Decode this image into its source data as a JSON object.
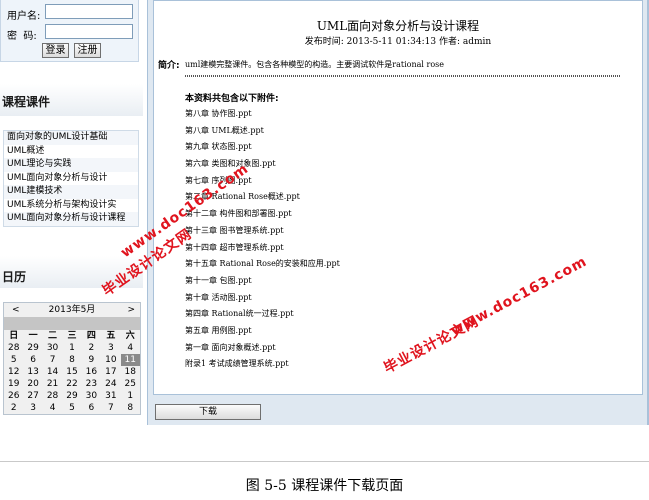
{
  "login": {
    "username_label": "用户名:",
    "password_label": "密  码:",
    "username_value": "",
    "password_value": "",
    "login_button": "登录",
    "register_button": "注册"
  },
  "courses": {
    "title": "课程课件",
    "items": [
      "面向对象的UML设计基础",
      "UML概述",
      "UML理论与实践",
      "UML面向对象分析与设计",
      "UML建模技术",
      "UML系统分析与架构设计实",
      "UML面向对象分析与设计课程"
    ]
  },
  "calendar": {
    "title": "日历",
    "month_label": "2013年5月",
    "prev": "<",
    "next": ">",
    "weekdays": [
      "日",
      "一",
      "二",
      "三",
      "四",
      "五",
      "六"
    ],
    "weeks": [
      [
        "28",
        "29",
        "30",
        "1",
        "2",
        "3",
        "4"
      ],
      [
        "5",
        "6",
        "7",
        "8",
        "9",
        "10",
        "11"
      ],
      [
        "12",
        "13",
        "14",
        "15",
        "16",
        "17",
        "18"
      ],
      [
        "19",
        "20",
        "21",
        "22",
        "23",
        "24",
        "25"
      ],
      [
        "26",
        "27",
        "28",
        "29",
        "30",
        "31",
        "1"
      ],
      [
        "2",
        "3",
        "4",
        "5",
        "6",
        "7",
        "8"
      ]
    ],
    "today": "11"
  },
  "document": {
    "title": "UML面向对象分析与设计课程",
    "meta": "发布时间: 2013-5-11 01:34:13 作者: admin",
    "intro_label": "简介:",
    "intro_text": "uml建模完整课件。包含各种模型的构造。主要调试软件是rational rose",
    "separator": "==========================================================================================",
    "attachments_heading": "本资料共包含以下附件:",
    "attachments": [
      "第八章 协作图.ppt",
      "第八章 UML概述.ppt",
      "第九章 状态图.ppt",
      "第六章 类图和对象图.ppt",
      "第七章 序列图.ppt",
      "第二章 Rational Rose概述.ppt",
      "第十二章 构件图和部署图.ppt",
      "第十三章 图书管理系统.ppt",
      "第十四章 超市管理系统.ppt",
      "第十五章 Rational Rose的安装和应用.ppt",
      "第十一章 包图.ppt",
      "第十章 活动图.ppt",
      "第四章 Rational统一过程.ppt",
      "第五章 用例图.ppt",
      "第一章 面向对象概述.ppt",
      "附录1 考试成绩管理系统.ppt"
    ],
    "download_button": "下载"
  },
  "watermark": {
    "text_cn": "毕业设计论文网",
    "text_url": "www.doc163.com"
  },
  "caption": "图 5-5 课程课件下载页面"
}
